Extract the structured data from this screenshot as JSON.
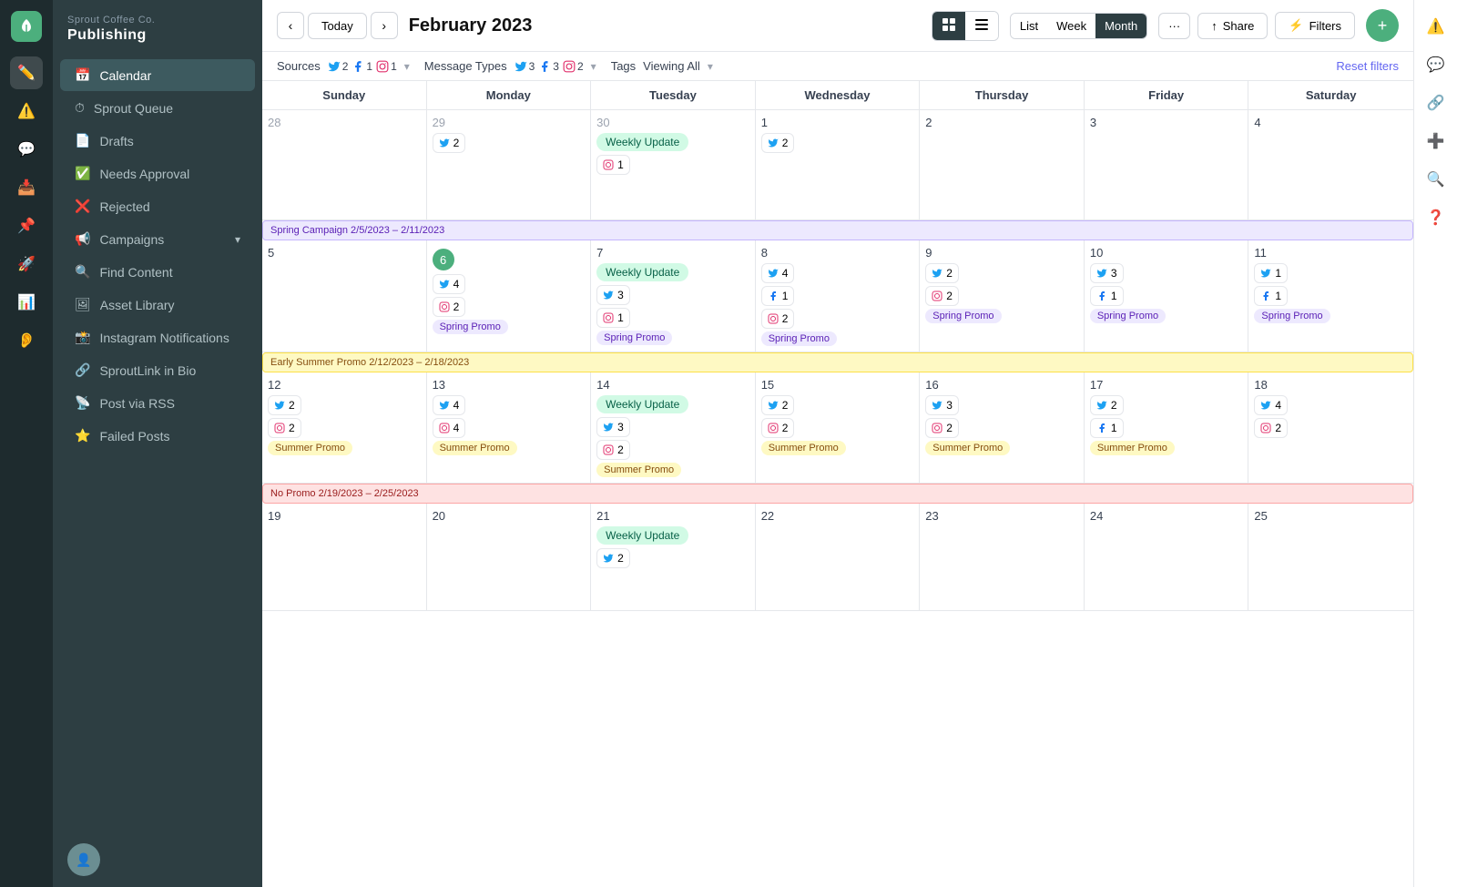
{
  "app": {
    "logo_letter": "🌱",
    "company": "Sprout Coffee Co.",
    "section": "Publishing"
  },
  "sidebar": {
    "nav_items": [
      {
        "id": "calendar",
        "label": "Calendar",
        "active": true
      },
      {
        "id": "sprout-queue",
        "label": "Sprout Queue"
      },
      {
        "id": "drafts",
        "label": "Drafts"
      },
      {
        "id": "needs-approval",
        "label": "Needs Approval"
      },
      {
        "id": "rejected",
        "label": "Rejected"
      },
      {
        "id": "campaigns",
        "label": "Campaigns",
        "has_arrow": true
      },
      {
        "id": "find-content",
        "label": "Find Content"
      },
      {
        "id": "asset-library",
        "label": "Asset Library"
      },
      {
        "id": "instagram-notifications",
        "label": "Instagram Notifications"
      },
      {
        "id": "sproutlink",
        "label": "SproutLink in Bio"
      },
      {
        "id": "post-via-rss",
        "label": "Post via RSS"
      },
      {
        "id": "failed-posts",
        "label": "Failed Posts"
      }
    ]
  },
  "topbar": {
    "today_label": "Today",
    "month_title": "February 2023",
    "view_list": "List",
    "view_week": "Week",
    "view_month": "Month",
    "more_label": "···",
    "share_label": "Share",
    "filters_label": "Filters"
  },
  "filterbar": {
    "sources_label": "Sources",
    "sources": {
      "twitter": 2,
      "facebook": 1,
      "instagram": 1
    },
    "message_types_label": "Message Types",
    "message_types": {
      "twitter": 3,
      "facebook": 3,
      "instagram": 2
    },
    "tags_label": "Tags",
    "tags_value": "Viewing All",
    "reset_label": "Reset filters"
  },
  "calendar": {
    "headers": [
      "Sunday",
      "Monday",
      "Tuesday",
      "Wednesday",
      "Thursday",
      "Friday",
      "Saturday"
    ],
    "weeks": [
      {
        "campaign": null,
        "days": [
          {
            "num": "28",
            "other": true,
            "posts": []
          },
          {
            "num": "29",
            "other": true,
            "posts": [
              {
                "type": "twitter",
                "count": 2
              }
            ]
          },
          {
            "num": "30",
            "other": true,
            "weekly_update": true,
            "posts": [
              {
                "type": "instagram",
                "count": 1
              }
            ]
          },
          {
            "num": "1",
            "posts": [
              {
                "type": "twitter",
                "count": 2
              }
            ]
          },
          {
            "num": "2",
            "posts": []
          },
          {
            "num": "3",
            "posts": []
          },
          {
            "num": "4",
            "posts": []
          }
        ]
      },
      {
        "campaign": {
          "label": "Spring Campaign 2/5/2023 – 2/11/2023",
          "type": "spring"
        },
        "days": [
          {
            "num": "5",
            "posts": []
          },
          {
            "num": "6",
            "today": true,
            "posts": [
              {
                "type": "twitter",
                "count": 4
              },
              {
                "type": "instagram",
                "count": 2
              }
            ],
            "promo": "spring"
          },
          {
            "num": "7",
            "weekly_update": true,
            "posts": [
              {
                "type": "twitter",
                "count": 3
              },
              {
                "type": "instagram",
                "count": 1
              }
            ],
            "promo": "spring"
          },
          {
            "num": "8",
            "posts": [
              {
                "type": "twitter",
                "count": 4
              },
              {
                "type": "facebook",
                "count": 1
              },
              {
                "type": "instagram",
                "count": 2
              }
            ],
            "promo": "spring"
          },
          {
            "num": "9",
            "posts": [
              {
                "type": "twitter",
                "count": 2
              },
              {
                "type": "instagram",
                "count": 2
              }
            ],
            "promo": "spring"
          },
          {
            "num": "10",
            "posts": [
              {
                "type": "twitter",
                "count": 3
              },
              {
                "type": "facebook",
                "count": 1
              }
            ],
            "promo": "spring"
          },
          {
            "num": "11",
            "posts": [
              {
                "type": "twitter",
                "count": 1
              },
              {
                "type": "facebook",
                "count": 1
              }
            ],
            "promo": "spring"
          }
        ]
      },
      {
        "campaign": {
          "label": "Early Summer Promo 2/12/2023 – 2/18/2023",
          "type": "summer"
        },
        "days": [
          {
            "num": "12",
            "posts": [
              {
                "type": "twitter",
                "count": 2
              },
              {
                "type": "instagram",
                "count": 2
              }
            ],
            "promo": "summer"
          },
          {
            "num": "13",
            "posts": [
              {
                "type": "twitter",
                "count": 4
              },
              {
                "type": "instagram",
                "count": 4
              }
            ],
            "promo": "summer"
          },
          {
            "num": "14",
            "weekly_update": true,
            "posts": [
              {
                "type": "twitter",
                "count": 3
              },
              {
                "type": "instagram",
                "count": 2
              }
            ],
            "promo": "summer"
          },
          {
            "num": "15",
            "posts": [
              {
                "type": "twitter",
                "count": 2
              },
              {
                "type": "instagram",
                "count": 2
              }
            ],
            "promo": "summer"
          },
          {
            "num": "16",
            "posts": [
              {
                "type": "twitter",
                "count": 3
              },
              {
                "type": "instagram",
                "count": 2
              }
            ],
            "promo": "summer"
          },
          {
            "num": "17",
            "posts": [
              {
                "type": "twitter",
                "count": 2
              },
              {
                "type": "facebook",
                "count": 1
              }
            ],
            "promo": "summer"
          },
          {
            "num": "18",
            "posts": [
              {
                "type": "twitter",
                "count": 4
              },
              {
                "type": "instagram",
                "count": 2
              }
            ],
            "promo": "summer"
          }
        ]
      },
      {
        "campaign": {
          "label": "No Promo 2/19/2023 – 2/25/2023",
          "type": "nopromo"
        },
        "days": [
          {
            "num": "19",
            "posts": []
          },
          {
            "num": "20",
            "posts": []
          },
          {
            "num": "21",
            "weekly_update": true,
            "posts": [
              {
                "type": "twitter",
                "count": 2
              }
            ]
          },
          {
            "num": "22",
            "posts": []
          },
          {
            "num": "23",
            "posts": []
          },
          {
            "num": "24",
            "posts": []
          },
          {
            "num": "25",
            "posts": []
          }
        ]
      }
    ]
  }
}
